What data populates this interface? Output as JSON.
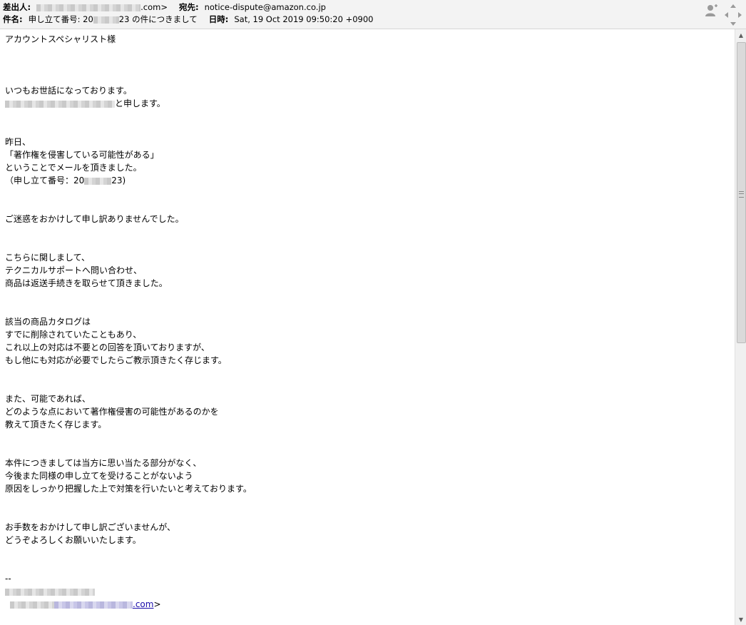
{
  "header": {
    "from_label": "差出人:",
    "from_value": ".com>",
    "to_label": "宛先:",
    "to_value": "notice-dispute@amazon.co.jp",
    "subject_label": "件名:",
    "subject_prefix": "申し立て番号: 20",
    "subject_suffix": "23 の件につきまして",
    "date_label": "日時:",
    "date_value": "Sat, 19 Oct 2019 09:50:20 +0900"
  },
  "icons": {
    "person": "person-add-icon",
    "navigation": "navigation-arrows-icon"
  },
  "body": {
    "greeting": "アカウントスペシャリスト様",
    "p1_l1": "いつもお世話になっております。",
    "p1_l2_suffix": "と申します。",
    "p2_l1": "昨日、",
    "p2_l2": "「著作権を侵害している可能性がある」",
    "p2_l3": "ということでメールを頂きました。",
    "p2_l4_prefix": "（申し立て番号：20",
    "p2_l4_suffix": "23)",
    "p3_l1": "ご迷惑をおかけして申し訳ありませんでした。",
    "p4_l1": "こちらに関しまして、",
    "p4_l2": "テクニカルサポートへ問い合わせ、",
    "p4_l3": "商品は返送手続きを取らせて頂きました。",
    "p5_l1": "該当の商品カタログは",
    "p5_l2": "すでに削除されていたこともあり、",
    "p5_l3": "これ以上の対応は不要との回答を頂いておりますが、",
    "p5_l4": "もし他にも対応が必要でしたらご教示頂きたく存じます。",
    "p6_l1": "また、可能であれば、",
    "p6_l2": "どのような点において著作権侵害の可能性があるのかを",
    "p6_l3": "教えて頂きたく存じます。",
    "p7_l1": "本件につきましては当方に思い当たる部分がなく、",
    "p7_l2": "今後また同様の申し立てを受けることがないよう",
    "p7_l3": "原因をしっかり把握した上で対策を行いたいと考えております。",
    "p8_l1": "お手数をおかけして申し訳ございませんが、",
    "p8_l2": "どうぞよろしくお願いいたします。",
    "sig_dash": "--",
    "sig_email_suffix": ".com",
    "sig_email_close": ">"
  },
  "scrollbar": {
    "up_arrow": "▲",
    "down_arrow": "▼"
  }
}
